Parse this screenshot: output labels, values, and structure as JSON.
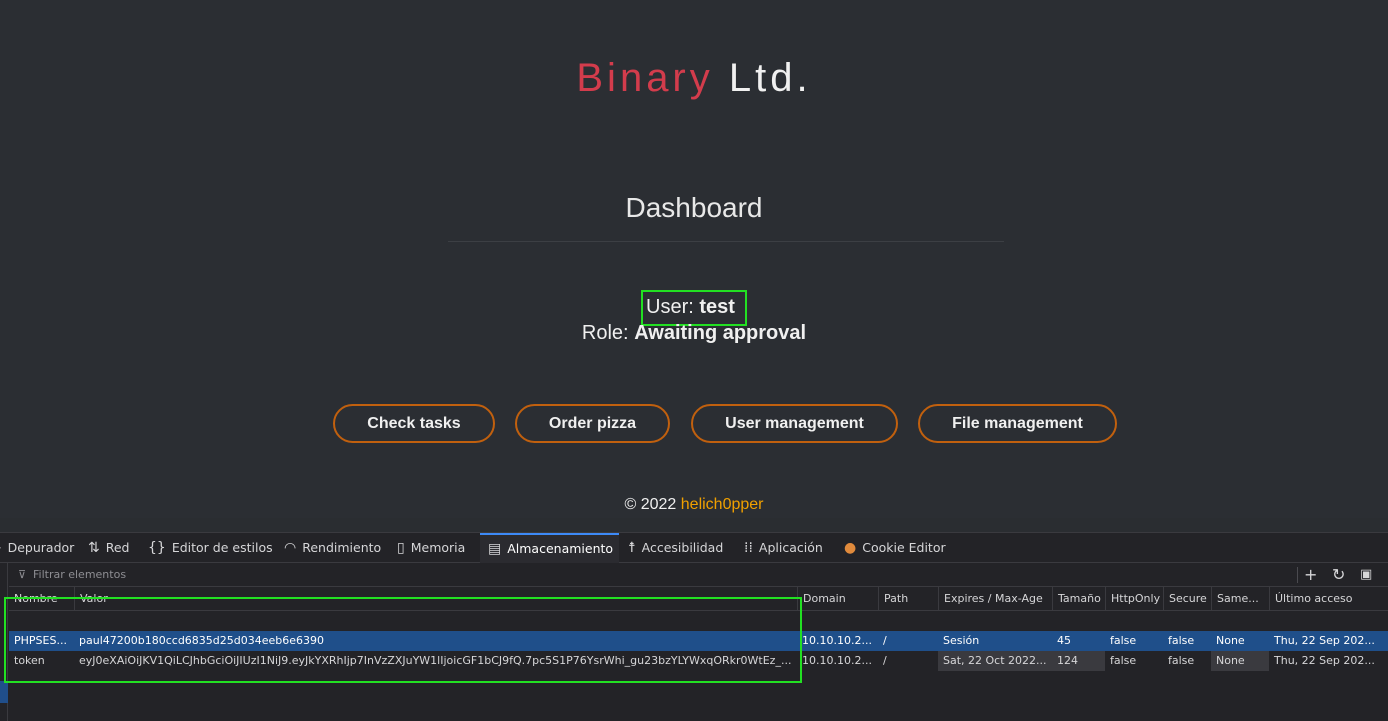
{
  "brand": {
    "part1": "Binary",
    "part2": "Ltd."
  },
  "dashboard": {
    "title": "Dashboard",
    "user_label": "User:",
    "user_value": "test",
    "role_label": "Role:",
    "role_value": "Awaiting approval"
  },
  "buttons": {
    "check_tasks": "Check tasks",
    "order_pizza": "Order pizza",
    "user_management": "User management",
    "file_management": "File management"
  },
  "footer": {
    "copyright": "© 2022",
    "author": "helich0pper"
  },
  "devtools": {
    "tabs": [
      {
        "label": "Depurador",
        "icon": "debugger-icon"
      },
      {
        "label": "Red",
        "icon": "network-icon"
      },
      {
        "label": "Editor de estilos",
        "icon": "style-editor-icon"
      },
      {
        "label": "Rendimiento",
        "icon": "performance-icon"
      },
      {
        "label": "Memoria",
        "icon": "memory-icon"
      },
      {
        "label": "Almacenamiento",
        "icon": "storage-icon",
        "active": true
      },
      {
        "label": "Accesibilidad",
        "icon": "accessibility-icon"
      },
      {
        "label": "Aplicación",
        "icon": "application-icon"
      },
      {
        "label": "Cookie Editor",
        "icon": "cookie-icon"
      }
    ],
    "filter_placeholder": "Filtrar elementos",
    "columns": [
      "Nombre",
      "Valor",
      "Domain",
      "Path",
      "Expires / Max-Age",
      "Tamaño",
      "HttpOnly",
      "Secure",
      "Same...",
      "Último acceso"
    ],
    "rows": [
      [
        "PHPSES...",
        "paul47200b180ccd6835d25d034eeb6e6390",
        "10.10.10.2...",
        "/",
        "Sesión",
        "45",
        "false",
        "false",
        "None",
        "Thu, 22 Sep 202..."
      ],
      [
        "token",
        "eyJ0eXAiOiJKV1QiLCJhbGciOiJIUzI1NiJ9.eyJkYXRhIjp7InVzZXJuYW1lIjoicGF1bCJ9fQ.7pc5S1P76YsrWhi_gu23bzYLYWxqORkr0WtEz_...",
        "10.10.10.2...",
        "/",
        "Sat, 22 Oct 2022...",
        "124",
        "false",
        "false",
        "None",
        "Thu, 22 Sep 202..."
      ]
    ]
  }
}
